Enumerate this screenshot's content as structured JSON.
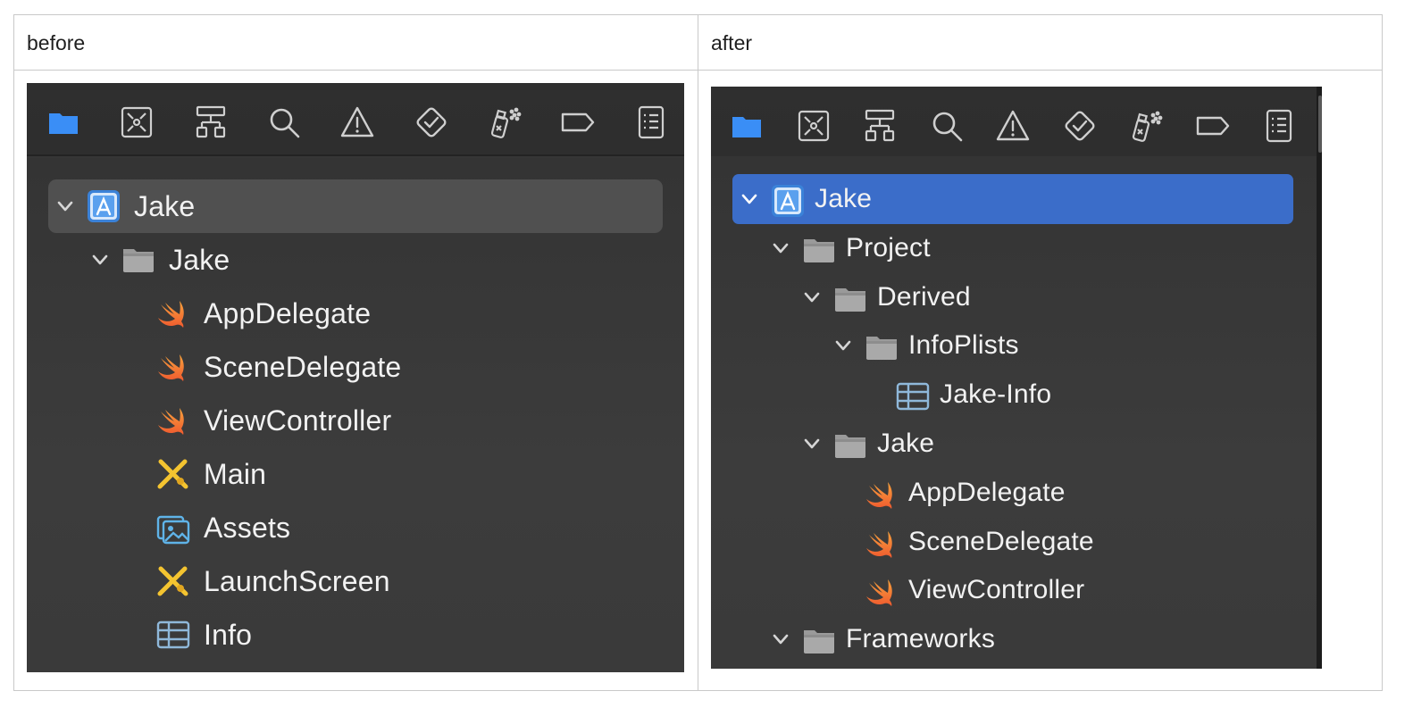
{
  "table": {
    "headers": [
      "before",
      "after"
    ]
  },
  "toolbar_icons": [
    "folder-icon",
    "source-control-icon",
    "hierarchy-icon",
    "search-icon",
    "warning-icon",
    "test-diamond-icon",
    "debug-spray-icon",
    "breakpoint-tag-icon",
    "report-list-icon"
  ],
  "colors": {
    "accent": "#3b6dc9",
    "swift_orange": "#f0883a",
    "folder_gray": "#9a9a9a",
    "toolbar_blue": "#3a8ef6"
  },
  "before": {
    "tree": [
      {
        "label": "Jake",
        "icon": "app-project-icon",
        "level": 0,
        "expanded": true,
        "selected": true
      },
      {
        "label": "Jake",
        "icon": "folder-icon",
        "level": 1,
        "expanded": true
      },
      {
        "label": "AppDelegate",
        "icon": "swift-file-icon",
        "level": 2
      },
      {
        "label": "SceneDelegate",
        "icon": "swift-file-icon",
        "level": 2
      },
      {
        "label": "ViewController",
        "icon": "swift-file-icon",
        "level": 2
      },
      {
        "label": "Main",
        "icon": "storyboard-icon",
        "level": 2
      },
      {
        "label": "Assets",
        "icon": "asset-catalog-icon",
        "level": 2
      },
      {
        "label": "LaunchScreen",
        "icon": "storyboard-icon",
        "level": 2
      },
      {
        "label": "Info",
        "icon": "plist-icon",
        "level": 2
      }
    ]
  },
  "after": {
    "tree": [
      {
        "label": "Jake",
        "icon": "app-project-icon",
        "level": 0,
        "expanded": true,
        "selected": true
      },
      {
        "label": "Project",
        "icon": "folder-icon",
        "level": 1,
        "expanded": true
      },
      {
        "label": "Derived",
        "icon": "folder-icon",
        "level": 2,
        "expanded": true
      },
      {
        "label": "InfoPlists",
        "icon": "folder-icon",
        "level": 3,
        "expanded": true
      },
      {
        "label": "Jake-Info",
        "icon": "plist-icon",
        "level": 4
      },
      {
        "label": "Jake",
        "icon": "folder-icon",
        "level": 2,
        "expanded": true
      },
      {
        "label": "AppDelegate",
        "icon": "swift-file-icon",
        "level": 3
      },
      {
        "label": "SceneDelegate",
        "icon": "swift-file-icon",
        "level": 3
      },
      {
        "label": "ViewController",
        "icon": "swift-file-icon",
        "level": 3
      },
      {
        "label": "Frameworks",
        "icon": "folder-icon",
        "level": 1,
        "expanded": true
      }
    ]
  }
}
